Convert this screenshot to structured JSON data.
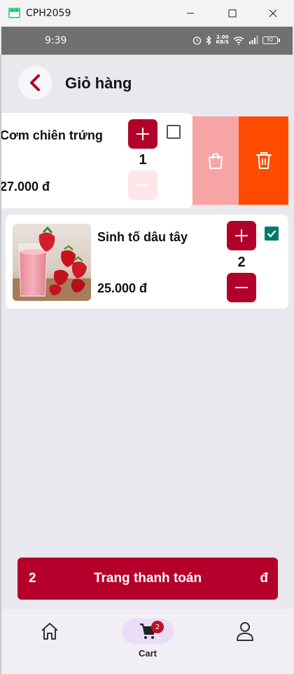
{
  "window": {
    "title": "CPH2059",
    "minimize_icon": "minimize-icon",
    "maximize_icon": "maximize-icon",
    "close_icon": "close-icon"
  },
  "status_bar": {
    "time": "9:39",
    "net_speed_value": "2.00",
    "net_speed_unit": "KB/S",
    "battery": "92"
  },
  "header": {
    "title": "Giỏ hàng",
    "back_icon": "chevron-left-icon"
  },
  "cart_items": [
    {
      "name": "Cơm chiên trứng",
      "price": "27.000 đ",
      "quantity": "1",
      "checked": false,
      "minus_enabled": false
    },
    {
      "name": "Sinh tố dâu tây",
      "price": "25.000 đ",
      "quantity": "2",
      "checked": true,
      "minus_enabled": true
    }
  ],
  "swipe_actions": {
    "bag_icon": "shopping-bag-icon",
    "delete_icon": "trash-icon"
  },
  "checkout": {
    "count": "2",
    "label": "Trang thanh toán",
    "total": "đ"
  },
  "bottom_nav": {
    "home_icon": "home-icon",
    "cart_icon": "cart-icon",
    "cart_label": "Cart",
    "cart_badge": "2",
    "account_icon": "person-icon"
  },
  "colors": {
    "primary": "#b1002a",
    "bag_action": "#f7a4a5",
    "delete_action": "#ff4b00",
    "checkbox_checked": "#00796b",
    "nav_active": "#e8dcf7"
  }
}
